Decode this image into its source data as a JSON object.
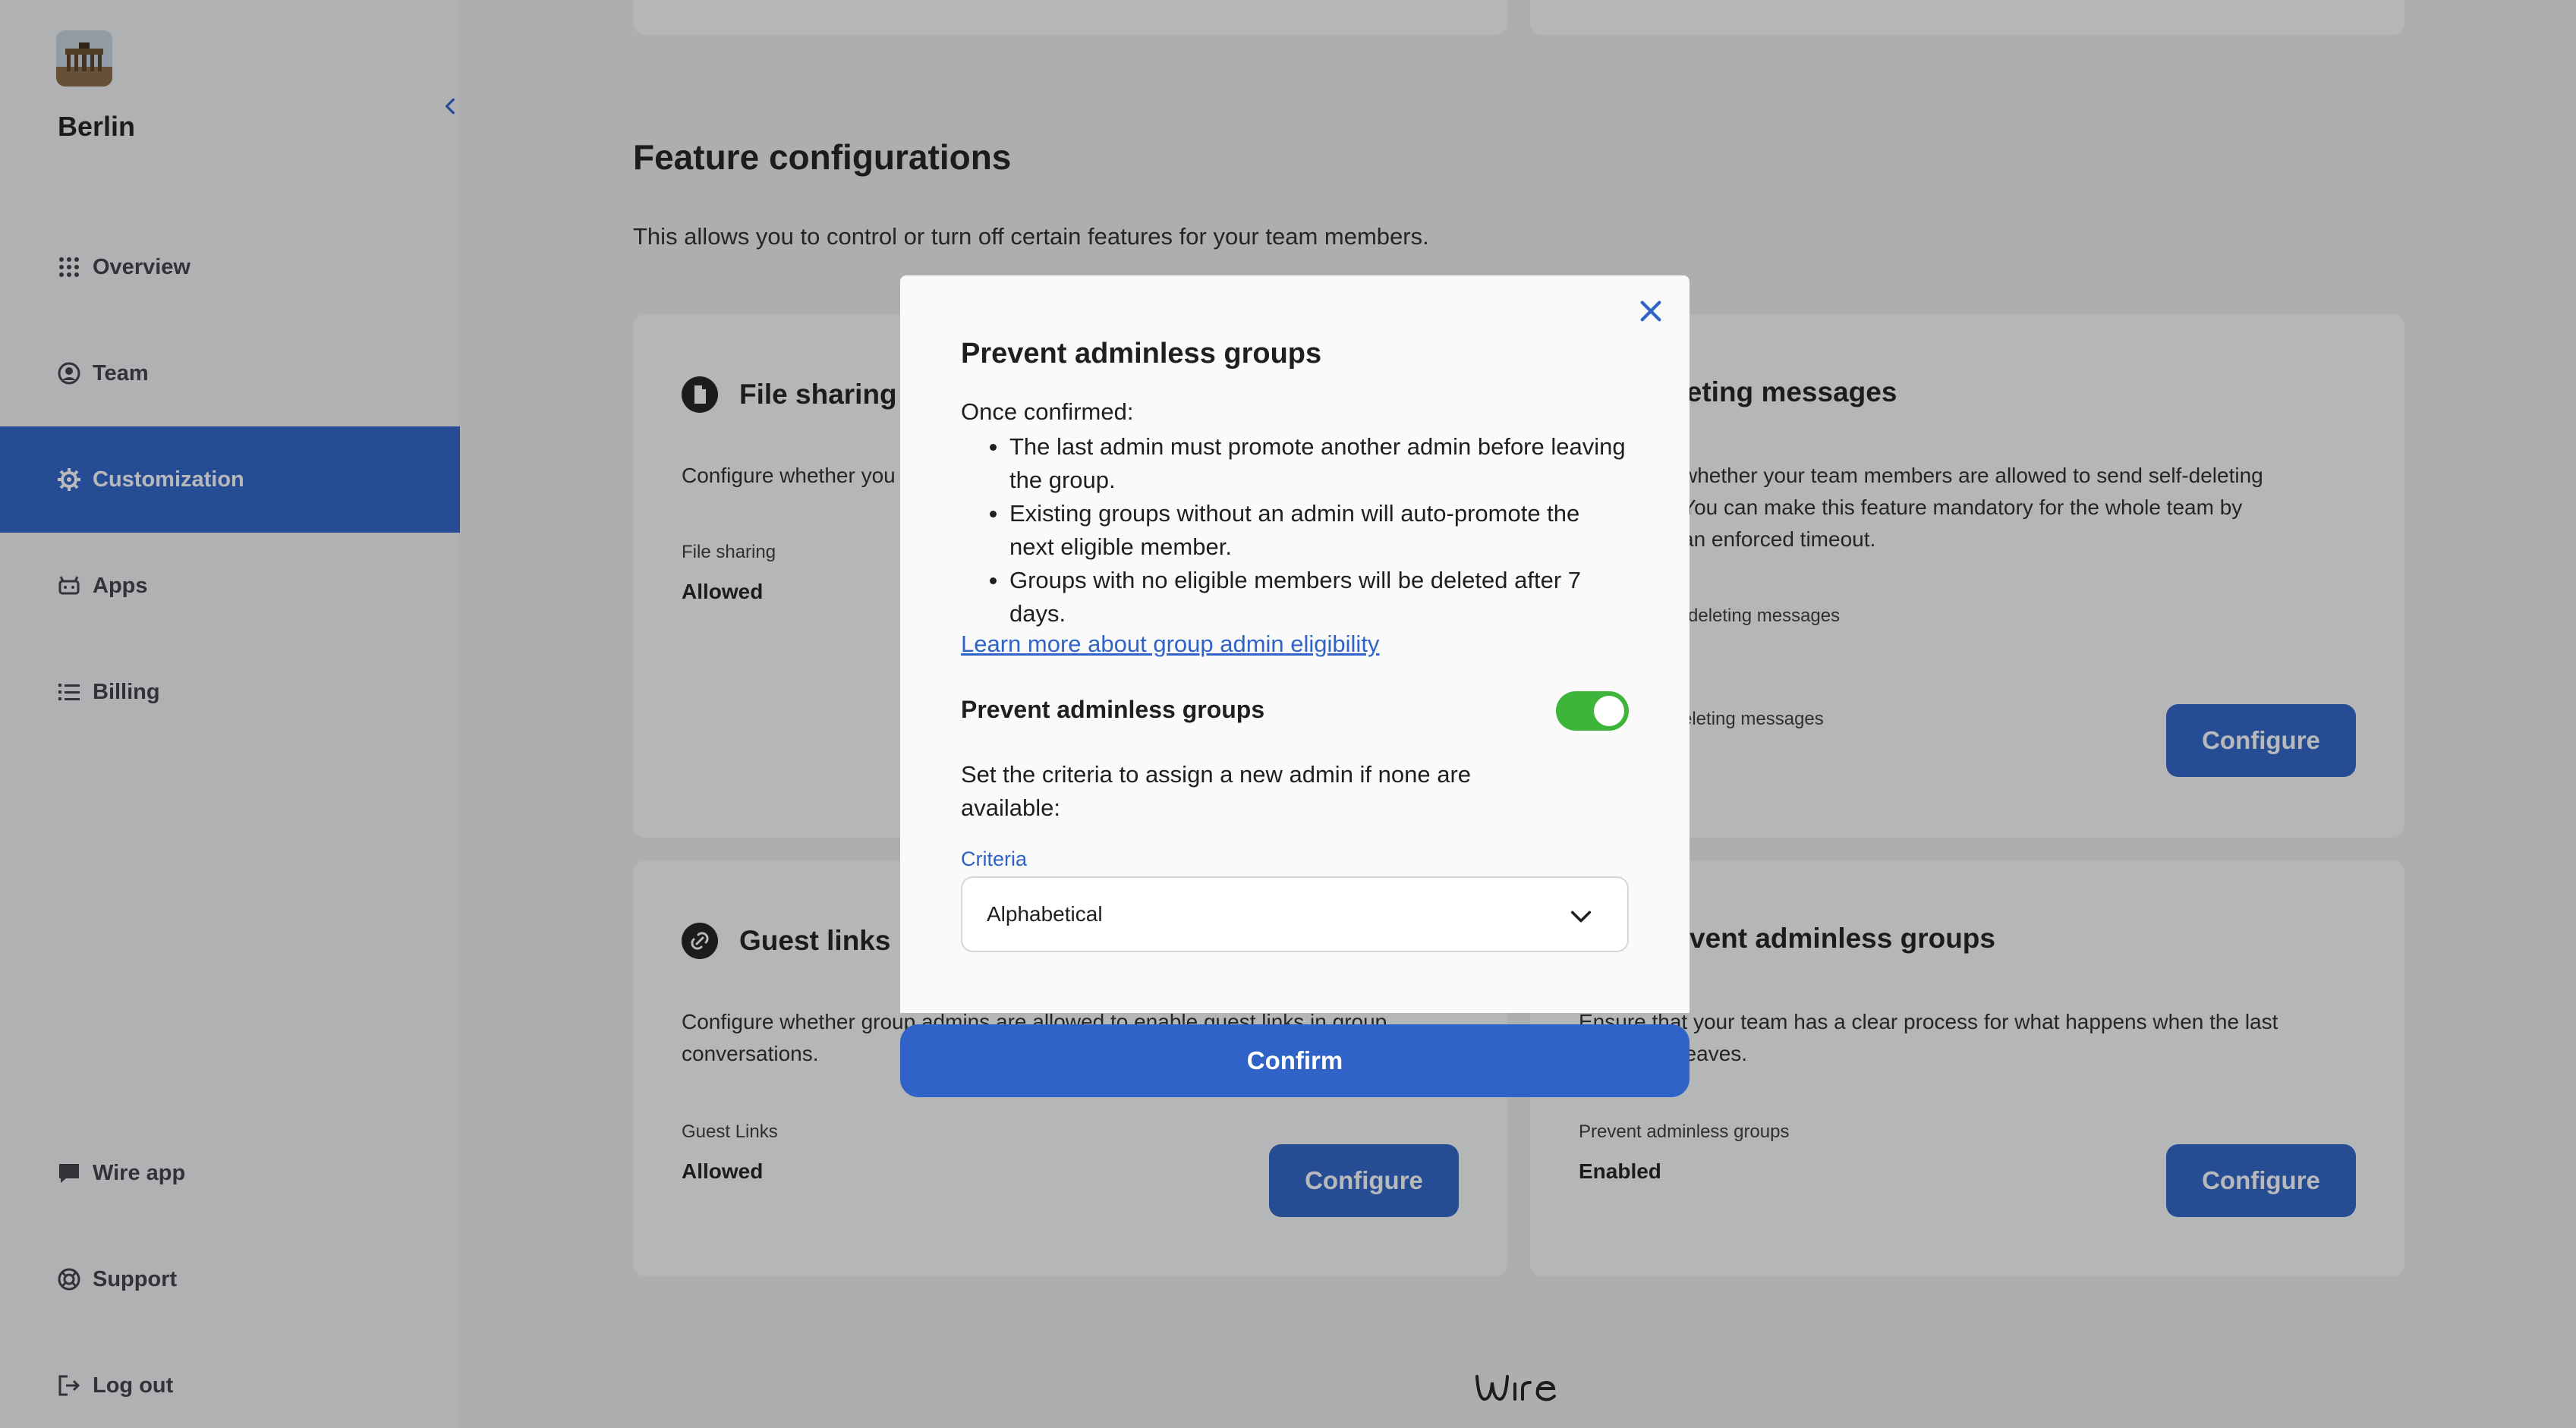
{
  "sidebar": {
    "team_name": "Berlin",
    "items": [
      {
        "label": "Overview",
        "icon": "grid-icon"
      },
      {
        "label": "Team",
        "icon": "user-circle-icon"
      },
      {
        "label": "Customization",
        "icon": "gear-icon"
      },
      {
        "label": "Apps",
        "icon": "robot-icon"
      },
      {
        "label": "Billing",
        "icon": "list-icon"
      }
    ],
    "bottom_items": [
      {
        "label": "Wire app",
        "icon": "chat-bubble-icon"
      },
      {
        "label": "Support",
        "icon": "lifebuoy-icon"
      },
      {
        "label": "Log out",
        "icon": "logout-icon"
      }
    ],
    "active_item": "Customization"
  },
  "main": {
    "section_title": "Feature configurations",
    "section_description": "This allows you to control or turn off certain features for your team members.",
    "cards": [
      {
        "title": "File sharing",
        "icon": "file-icon",
        "description": "Configure whether you",
        "label": "File sharing",
        "value": "Allowed"
      },
      {
        "title": "-deleting messages",
        "description_lines": [
          "whether your team members are allowed to send self-deleting",
          "You can make this feature mandatory for the whole team by",
          "an enforced timeout."
        ],
        "label": "-deleting messages",
        "label2": "eleting messages",
        "button": "Configure"
      },
      {
        "title": "Guest links",
        "icon": "link-icon",
        "description_lines": [
          "Configure whether group admins are allowed to enable guest links in group",
          "conversations."
        ],
        "label": "Guest Links",
        "value": "Allowed",
        "button": "Configure"
      },
      {
        "title": "vent adminless groups",
        "description_lines": [
          "Ensure that your team has a clear process for what happens when the last",
          "n leaves."
        ],
        "label": "Prevent adminless groups",
        "value": "Enabled",
        "button": "Configure"
      }
    ],
    "logo_text": "wire"
  },
  "modal": {
    "title": "Prevent adminless groups",
    "intro": "Once confirmed:",
    "bullets": [
      "The last admin must promote another admin before leaving the group.",
      "Existing groups without an admin will auto-promote the next eligible member.",
      "Groups with no eligible members will be deleted after 7 days."
    ],
    "link": "Learn more about group admin eligibility",
    "toggle_label": "Prevent adminless groups",
    "toggle_on": true,
    "criteria_text": "Set the criteria to assign a new admin if none are available:",
    "criteria_label": "Criteria",
    "criteria_value": "Alphabetical",
    "confirm": "Confirm"
  },
  "colors": {
    "accent": "#2f63c7",
    "toggle_on": "#3fb43a",
    "link": "#2f63c7"
  }
}
